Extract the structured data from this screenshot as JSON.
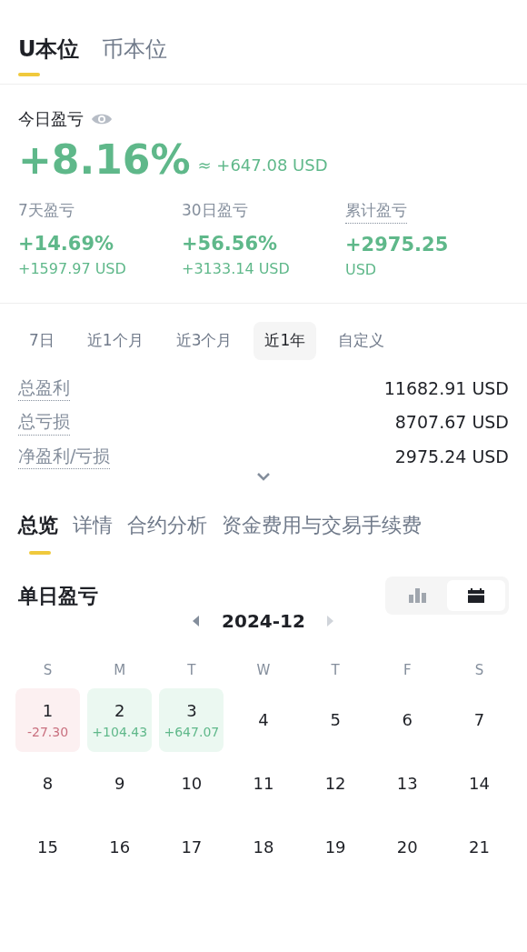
{
  "top_tabs": [
    {
      "label": "U本位",
      "selected": true
    },
    {
      "label": "币本位",
      "selected": false
    }
  ],
  "today": {
    "label": "今日盈亏",
    "percent": "+8.16%",
    "approx": "≈ +647.08 USD"
  },
  "periods": [
    {
      "label": "7天盈亏",
      "dotted": false,
      "value": "+14.69%",
      "sub": "+1597.97 USD"
    },
    {
      "label": "30日盈亏",
      "dotted": false,
      "value": "+56.56%",
      "sub": "+3133.14 USD"
    },
    {
      "label": "累计盈亏",
      "dotted": true,
      "value": "+2975.25",
      "sub": "USD"
    }
  ],
  "range_tabs": [
    {
      "label": "7日",
      "selected": false
    },
    {
      "label": "近1个月",
      "selected": false
    },
    {
      "label": "近3个月",
      "selected": false
    },
    {
      "label": "近1年",
      "selected": true
    },
    {
      "label": "自定义",
      "selected": false
    }
  ],
  "summary": [
    {
      "label": "总盈利",
      "value": "11682.91 USD"
    },
    {
      "label": "总亏损",
      "value": "8707.67 USD"
    },
    {
      "label": "净盈利/亏损",
      "value": "2975.24 USD"
    }
  ],
  "section_tabs": [
    {
      "label": "总览",
      "selected": true
    },
    {
      "label": "详情",
      "selected": false
    },
    {
      "label": "合约分析",
      "selected": false
    },
    {
      "label": "资金费用与交易手续费",
      "selected": false
    }
  ],
  "daily": {
    "title": "单日盈亏",
    "views": [
      {
        "kind": "chart",
        "selected": false
      },
      {
        "kind": "calendar",
        "selected": true
      }
    ],
    "month": "2024-12",
    "weekdays": [
      "S",
      "M",
      "T",
      "W",
      "T",
      "F",
      "S"
    ],
    "days": [
      {
        "day": "1",
        "pnl": "-27.30",
        "loss": true
      },
      {
        "day": "2",
        "pnl": "+104.43",
        "loss": false
      },
      {
        "day": "3",
        "pnl": "+647.07",
        "loss": false
      },
      {
        "day": "4"
      },
      {
        "day": "5"
      },
      {
        "day": "6"
      },
      {
        "day": "7"
      },
      {
        "day": "8"
      },
      {
        "day": "9"
      },
      {
        "day": "10"
      },
      {
        "day": "11"
      },
      {
        "day": "12"
      },
      {
        "day": "13"
      },
      {
        "day": "14"
      },
      {
        "day": "15"
      },
      {
        "day": "16"
      },
      {
        "day": "17"
      },
      {
        "day": "18"
      },
      {
        "day": "19"
      },
      {
        "day": "20"
      },
      {
        "day": "21"
      }
    ]
  }
}
